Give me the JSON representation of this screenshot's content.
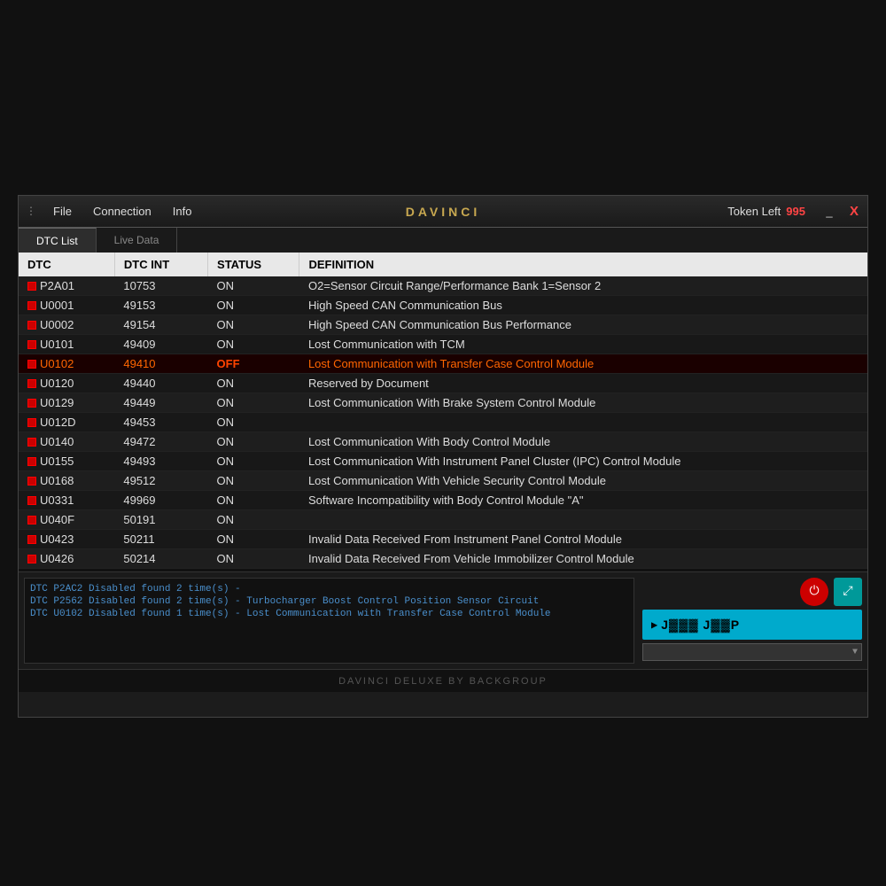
{
  "app": {
    "title": "DAVINCI",
    "footer": "DAVINCI DELUXE BY BACKGROUP",
    "token_label": "Token Left",
    "token_value": "995",
    "window_minimize": "_",
    "window_close": "X"
  },
  "menu": {
    "drag_icon": "⋮",
    "items": [
      "File",
      "Connection",
      "Info"
    ]
  },
  "tabs": [
    {
      "label": "DTC List",
      "active": true
    },
    {
      "label": "Live Data",
      "active": false
    }
  ],
  "table": {
    "headers": [
      "DTC",
      "DTC INT",
      "STATUS",
      "DEFINITION"
    ],
    "rows": [
      {
        "dtc": "P2A01",
        "dtc_int": "10753",
        "status": "ON",
        "definition": "O2=Sensor Circuit Range/Performance Bank 1=Sensor 2",
        "highlight": false,
        "checked": true
      },
      {
        "dtc": "U0001",
        "dtc_int": "49153",
        "status": "ON",
        "definition": "High Speed CAN Communication Bus",
        "highlight": false,
        "checked": true
      },
      {
        "dtc": "U0002",
        "dtc_int": "49154",
        "status": "ON",
        "definition": "High Speed CAN Communication Bus Performance",
        "highlight": false,
        "checked": true
      },
      {
        "dtc": "U0101",
        "dtc_int": "49409",
        "status": "ON",
        "definition": "Lost Communication with TCM",
        "highlight": false,
        "checked": true
      },
      {
        "dtc": "U0102",
        "dtc_int": "49410",
        "status": "OFF",
        "definition": "Lost Communication with Transfer Case Control Module",
        "highlight": true,
        "checked": true
      },
      {
        "dtc": "U0120",
        "dtc_int": "49440",
        "status": "ON",
        "definition": "Reserved by Document",
        "highlight": false,
        "checked": true
      },
      {
        "dtc": "U0129",
        "dtc_int": "49449",
        "status": "ON",
        "definition": "Lost Communication With Brake System Control Module",
        "highlight": false,
        "checked": true
      },
      {
        "dtc": "U012D",
        "dtc_int": "49453",
        "status": "ON",
        "definition": "",
        "highlight": false,
        "checked": true
      },
      {
        "dtc": "U0140",
        "dtc_int": "49472",
        "status": "ON",
        "definition": "Lost Communication With Body Control Module",
        "highlight": false,
        "checked": true
      },
      {
        "dtc": "U0155",
        "dtc_int": "49493",
        "status": "ON",
        "definition": "Lost Communication With Instrument Panel Cluster (IPC) Control Module",
        "highlight": false,
        "checked": true
      },
      {
        "dtc": "U0168",
        "dtc_int": "49512",
        "status": "ON",
        "definition": "Lost Communication With Vehicle Security Control Module",
        "highlight": false,
        "checked": true
      },
      {
        "dtc": "U0331",
        "dtc_int": "49969",
        "status": "ON",
        "definition": "Software Incompatibility with Body Control Module \"A\"",
        "highlight": false,
        "checked": true
      },
      {
        "dtc": "U040F",
        "dtc_int": "50191",
        "status": "ON",
        "definition": "",
        "highlight": false,
        "checked": true
      },
      {
        "dtc": "U0423",
        "dtc_int": "50211",
        "status": "ON",
        "definition": "Invalid Data Received From Instrument Panel Control Module",
        "highlight": false,
        "checked": true
      },
      {
        "dtc": "U0426",
        "dtc_int": "50214",
        "status": "ON",
        "definition": "Invalid Data Received From Vehicle Immobilizer Control Module",
        "highlight": false,
        "checked": true
      }
    ]
  },
  "log": {
    "lines": [
      "DTC P2AC2 Disabled found 2 time(s) -",
      "DTC P2562 Disabled found 2 time(s) - Turbocharger Boost Control Position Sensor Circuit",
      "DTC U0102 Disabled found 1 time(s) - Lost Communication with Transfer Case Control Module"
    ]
  },
  "vehicle_panel": {
    "text": "J▓▓▓ J▓▓P",
    "play_icon": "▶"
  },
  "icons": {
    "power": "⏻",
    "expand": "⤢"
  }
}
